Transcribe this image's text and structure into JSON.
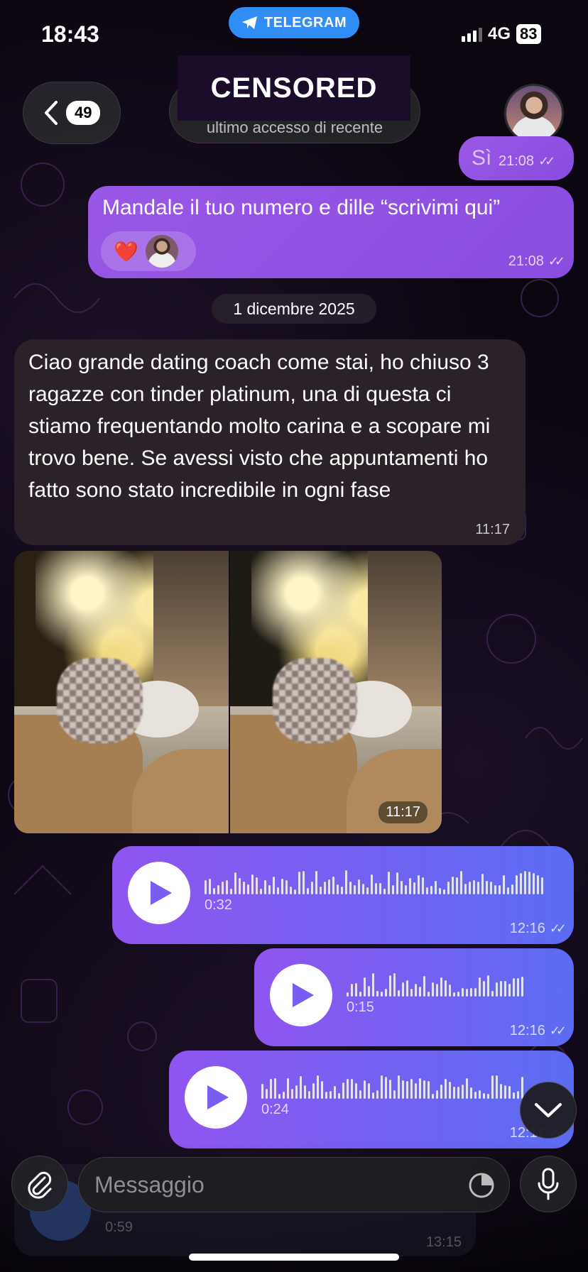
{
  "status": {
    "time": "18:43",
    "app_pill": "TELEGRAM",
    "network": "4G",
    "battery": "83"
  },
  "header": {
    "unread_count": "49",
    "title": "CENSORED",
    "subtitle": "ultimo accesso di recente"
  },
  "messages": {
    "m1": {
      "text": "Sì",
      "time": "21:08"
    },
    "m2": {
      "text": "Mandale il tuo numero e dille “scrivimi qui”",
      "time": "21:08",
      "reaction": "❤️"
    },
    "date_separator": "1 dicembre 2025",
    "m3": {
      "text": "Ciao grande dating coach come stai, ho chiuso 3 ragazze con tinder platinum, una di questa ci stiamo frequentando molto carina e a scopare mi trovo bene. Se avessi visto che appuntamenti ho fatto sono stato incredibile in ogni fase",
      "time": "11:17"
    },
    "photos": {
      "time": "11:17"
    },
    "voice1": {
      "duration": "0:32",
      "time": "12:16"
    },
    "voice2": {
      "duration": "0:15",
      "time": "12:16"
    },
    "voice3": {
      "duration": "0:24",
      "time": "12:17"
    },
    "ghost": {
      "duration": "0:59",
      "time": "13:15"
    }
  },
  "composer": {
    "placeholder": "Messaggio"
  },
  "icons": [
    "chevron-left-icon",
    "paperclip-icon",
    "sticker-icon",
    "microphone-icon",
    "chevron-down-icon",
    "play-icon",
    "telegram-icon",
    "double-check-icon"
  ],
  "colors": {
    "outgoing_bubble": "#9a57e6",
    "voice_bubble_end": "#5b6cf2",
    "incoming_bubble": "#2a2228",
    "telegram_blue": "#2f8df5"
  }
}
